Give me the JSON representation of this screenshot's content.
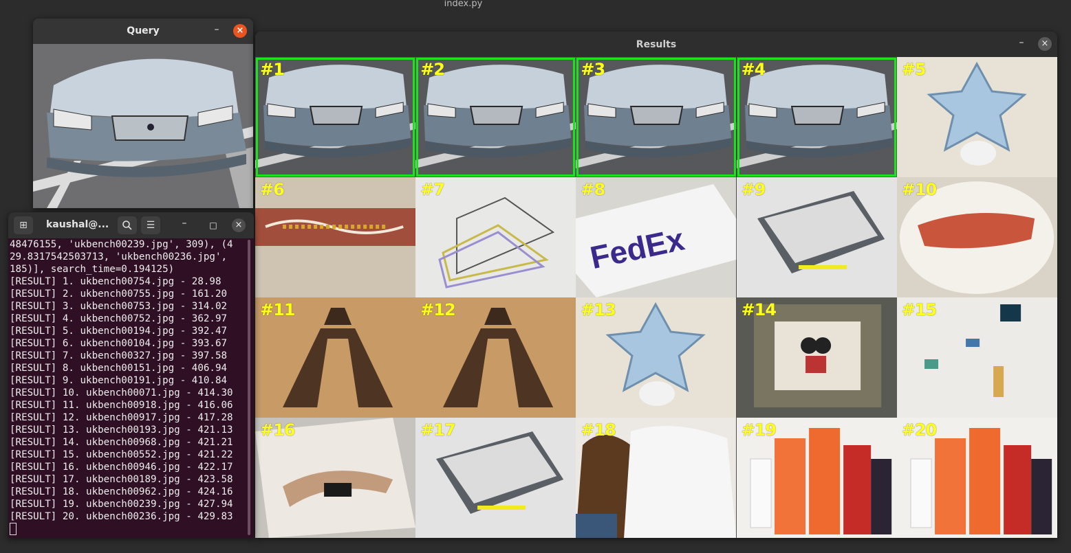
{
  "desktop": {
    "title": "index.py"
  },
  "query_window": {
    "title": "Query",
    "minimize": "–",
    "close": "×",
    "image": "query-car-image"
  },
  "results_window": {
    "title": "Results",
    "minimize": "–",
    "close": "×",
    "highlight_color": "#19e319",
    "label_color": "#ffff1e",
    "results": [
      {
        "rank": "#1",
        "subject": "car",
        "highlighted": true
      },
      {
        "rank": "#2",
        "subject": "car",
        "highlighted": true
      },
      {
        "rank": "#3",
        "subject": "car",
        "highlighted": true
      },
      {
        "rank": "#4",
        "subject": "car",
        "highlighted": true
      },
      {
        "rank": "#5",
        "subject": "star-box",
        "highlighted": false
      },
      {
        "rank": "#6",
        "subject": "painted-stick",
        "highlighted": false
      },
      {
        "rank": "#7",
        "subject": "hangers",
        "highlighted": false
      },
      {
        "rank": "#8",
        "subject": "fedex-box",
        "highlighted": false
      },
      {
        "rank": "#9",
        "subject": "router",
        "highlighted": false
      },
      {
        "rank": "#10",
        "subject": "plate",
        "highlighted": false
      },
      {
        "rank": "#11",
        "subject": "tower",
        "highlighted": false
      },
      {
        "rank": "#12",
        "subject": "tower",
        "highlighted": false
      },
      {
        "rank": "#13",
        "subject": "star-box",
        "highlighted": false
      },
      {
        "rank": "#14",
        "subject": "frame",
        "highlighted": false
      },
      {
        "rank": "#15",
        "subject": "fridge",
        "highlighted": false
      },
      {
        "rank": "#16",
        "subject": "magazine",
        "highlighted": false
      },
      {
        "rank": "#17",
        "subject": "router",
        "highlighted": false
      },
      {
        "rank": "#18",
        "subject": "polo-magazine",
        "highlighted": false
      },
      {
        "rank": "#19",
        "subject": "bottles",
        "highlighted": false
      },
      {
        "rank": "#20",
        "subject": "bottles",
        "highlighted": false
      }
    ]
  },
  "terminal": {
    "title": "kaushal@...",
    "buttons": {
      "new_tab": "+",
      "search": "search-icon",
      "menu": "menu-icon",
      "minimize": "–",
      "maximize": "□",
      "close": "×"
    },
    "lines": [
      "48476155, 'ukbench00239.jpg', 309), (4",
      "29.8317542503713, 'ukbench00236.jpg',",
      "185)], search_time=0.194125)",
      "[RESULT] 1. ukbench00754.jpg - 28.98",
      "[RESULT] 2. ukbench00755.jpg - 161.20",
      "[RESULT] 3. ukbench00753.jpg - 314.02",
      "[RESULT] 4. ukbench00752.jpg - 362.97",
      "[RESULT] 5. ukbench00194.jpg - 392.47",
      "[RESULT] 6. ukbench00104.jpg - 393.67",
      "[RESULT] 7. ukbench00327.jpg - 397.58",
      "[RESULT] 8. ukbench00151.jpg - 406.94",
      "[RESULT] 9. ukbench00191.jpg - 410.84",
      "[RESULT] 10. ukbench00071.jpg - 414.30",
      "[RESULT] 11. ukbench00918.jpg - 416.06",
      "[RESULT] 12. ukbench00917.jpg - 417.28",
      "[RESULT] 13. ukbench00193.jpg - 421.13",
      "[RESULT] 14. ukbench00968.jpg - 421.21",
      "[RESULT] 15. ukbench00552.jpg - 421.22",
      "[RESULT] 16. ukbench00946.jpg - 422.17",
      "[RESULT] 17. ukbench00189.jpg - 423.58",
      "[RESULT] 18. ukbench00962.jpg - 424.16",
      "[RESULT] 19. ukbench00239.jpg - 427.94",
      "[RESULT] 20. ukbench00236.jpg - 429.83"
    ]
  }
}
